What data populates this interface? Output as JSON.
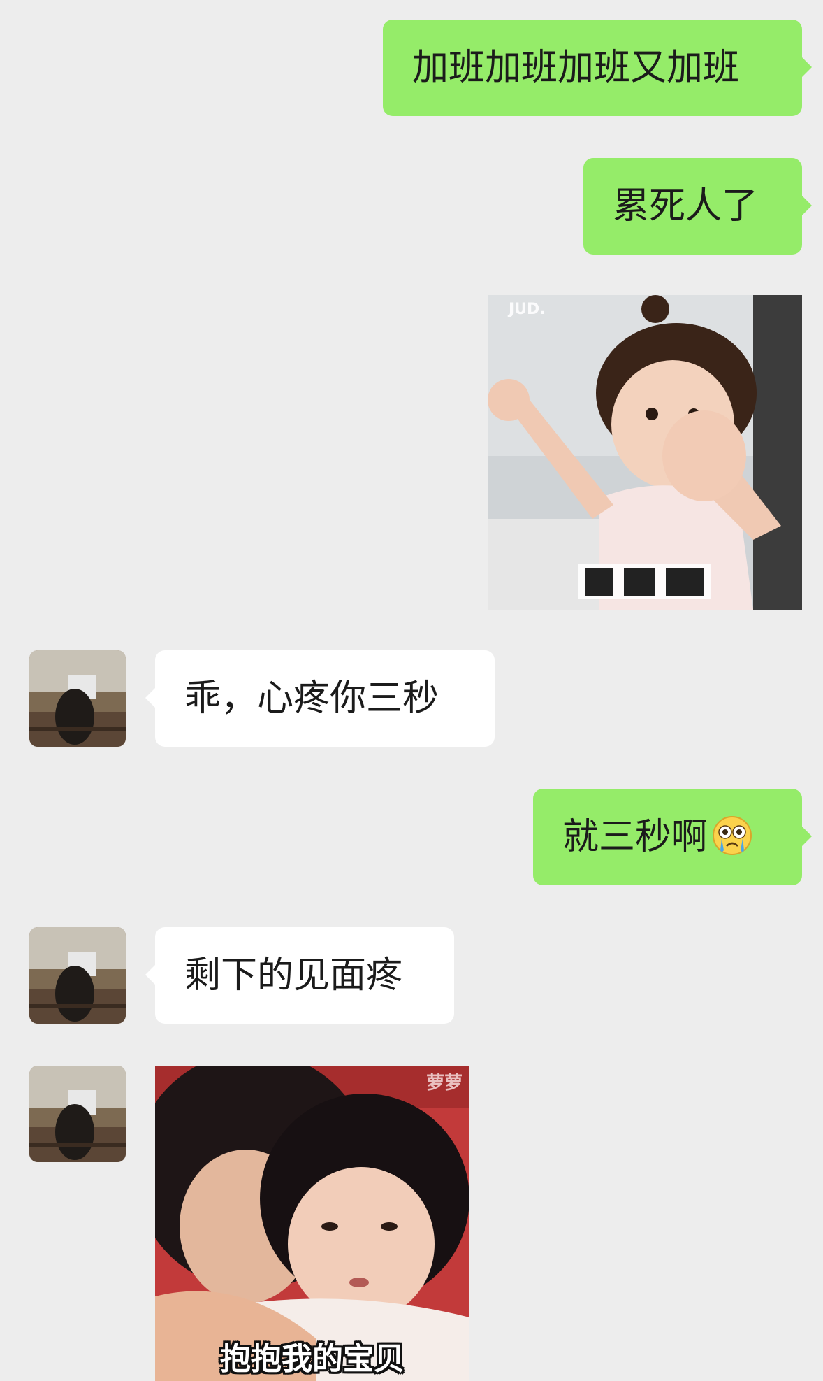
{
  "messages": [
    {
      "id": "m1",
      "side": "out",
      "type": "text",
      "text": "加班加班加班又加班"
    },
    {
      "id": "m2",
      "side": "out",
      "type": "text",
      "text": "累死人了"
    },
    {
      "id": "m3",
      "side": "out",
      "type": "sticker",
      "watermark": "JUD.",
      "caption": ""
    },
    {
      "id": "m4",
      "side": "in",
      "type": "text",
      "text": "乖，心疼你三秒"
    },
    {
      "id": "m5",
      "side": "out",
      "type": "text",
      "text": "就三秒啊",
      "emoji": "crying-face"
    },
    {
      "id": "m6",
      "side": "in",
      "type": "text",
      "text": "剩下的见面疼"
    },
    {
      "id": "m7",
      "side": "in",
      "type": "sticker",
      "watermark": "萝萝",
      "caption": "抱抱我的宝贝"
    }
  ],
  "colors": {
    "background": "#ededed",
    "outgoing_bubble": "#95ec69",
    "incoming_bubble": "#ffffff",
    "text": "#1b1b1b"
  }
}
